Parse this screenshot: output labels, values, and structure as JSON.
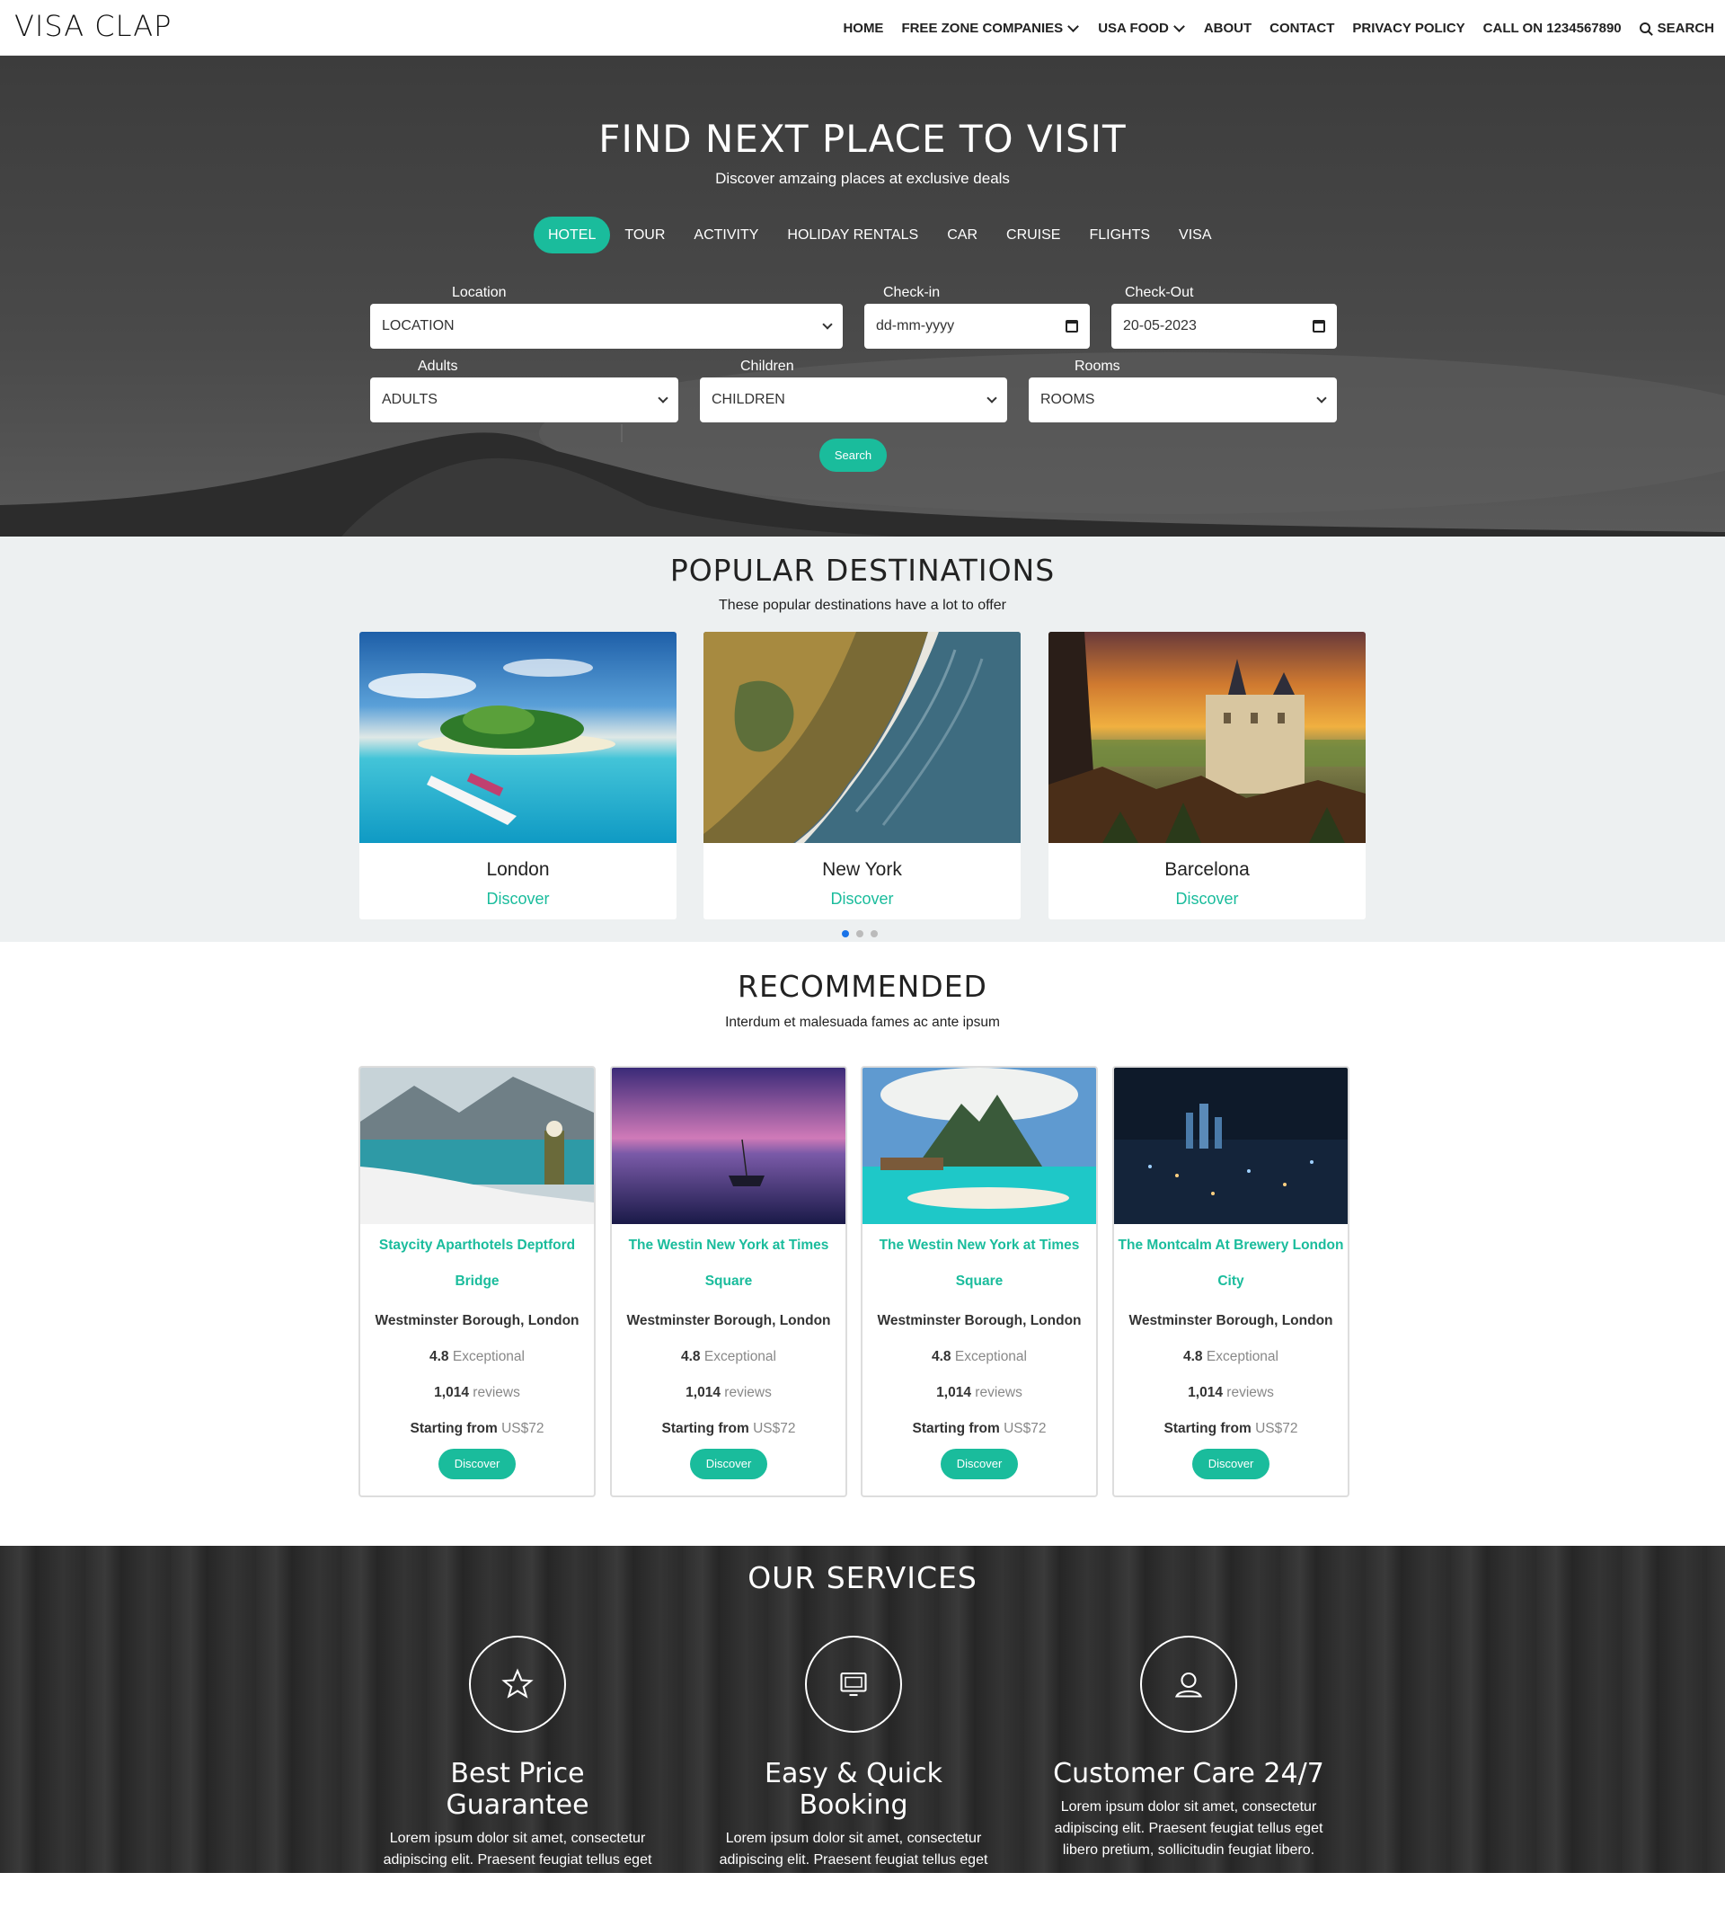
{
  "nav": {
    "logo": "VISA CLAP",
    "items": [
      "HOME",
      "FREE ZONE COMPANIES",
      "USA FOOD",
      "ABOUT",
      "CONTACT",
      "PRIVACY POLICY",
      "CALL ON 1234567890",
      "SEARCH"
    ]
  },
  "hero": {
    "title": "FIND NEXT PLACE TO VISIT",
    "subtitle": "Discover amzaing places at exclusive deals",
    "tabs": [
      "HOTEL",
      "TOUR",
      "ACTIVITY",
      "HOLIDAY RENTALS",
      "CAR",
      "CRUISE",
      "FLIGHTS",
      "VISA"
    ],
    "active_tab": "HOTEL",
    "form": {
      "location_label": "Location",
      "location_value": "LOCATION",
      "checkin_label": "Check-in",
      "checkin_value": "dd-mm-yyyy",
      "checkout_label": "Check-Out",
      "checkout_value": "20-05-2023",
      "adults_label": "Adults",
      "adults_value": "ADULTS",
      "children_label": "Children",
      "children_value": "CHILDREN",
      "rooms_label": "Rooms",
      "rooms_value": "ROOMS",
      "search_label": "Search"
    }
  },
  "popular": {
    "title": "POPULAR DESTINATIONS",
    "subtitle": "These popular destinations have a lot to offer",
    "cards": [
      {
        "name": "London",
        "link": "Discover"
      },
      {
        "name": "New York",
        "link": "Discover"
      },
      {
        "name": "Barcelona",
        "link": "Discover"
      }
    ]
  },
  "recommended": {
    "title": "RECOMMENDED",
    "subtitle": "Interdum et malesuada fames ac ante ipsum",
    "cards": [
      {
        "title": "Staycity Aparthotels Deptford Bridge",
        "location": "Westminster Borough, London",
        "rating": "4.8",
        "rating_text": "Exceptional",
        "reviews": "1,014",
        "reviews_text": "reviews",
        "price_label": "Starting from",
        "price": "US$72",
        "button": "Discover"
      },
      {
        "title": "The Westin New York at Times Square",
        "location": "Westminster Borough, London",
        "rating": "4.8",
        "rating_text": "Exceptional",
        "reviews": "1,014",
        "reviews_text": "reviews",
        "price_label": "Starting from",
        "price": "US$72",
        "button": "Discover"
      },
      {
        "title": "The Westin New York at Times Square",
        "location": "Westminster Borough, London",
        "rating": "4.8",
        "rating_text": "Exceptional",
        "reviews": "1,014",
        "reviews_text": "reviews",
        "price_label": "Starting from",
        "price": "US$72",
        "button": "Discover"
      },
      {
        "title": "The Montcalm At Brewery London City",
        "location": "Westminster Borough, London",
        "rating": "4.8",
        "rating_text": "Exceptional",
        "reviews": "1,014",
        "reviews_text": "reviews",
        "price_label": "Starting from",
        "price": "US$72",
        "button": "Discover"
      }
    ]
  },
  "services": {
    "title": "OUR SERVICES",
    "items": [
      {
        "icon": "star-icon",
        "title": "Best Price Guarantee",
        "text": "Lorem ipsum dolor sit amet, consectetur adipiscing elit. Praesent feugiat tellus eget libero pretium, sollicitudin feugiat libero."
      },
      {
        "icon": "monitor-icon",
        "title": "Easy & Quick Booking",
        "text": "Lorem ipsum dolor sit amet, consectetur adipiscing elit. Praesent feugiat tellus eget libero pretium, sollicitudin feugiat libero."
      },
      {
        "icon": "user-icon",
        "title": "Customer Care 24/7",
        "text": "Lorem ipsum dolor sit amet, consectetur adipiscing elit. Praesent feugiat tellus eget libero pretium, sollicitudin feugiat libero."
      }
    ]
  },
  "colors": {
    "accent": "#1abc9c",
    "carousel_active": "#1a73e8"
  }
}
